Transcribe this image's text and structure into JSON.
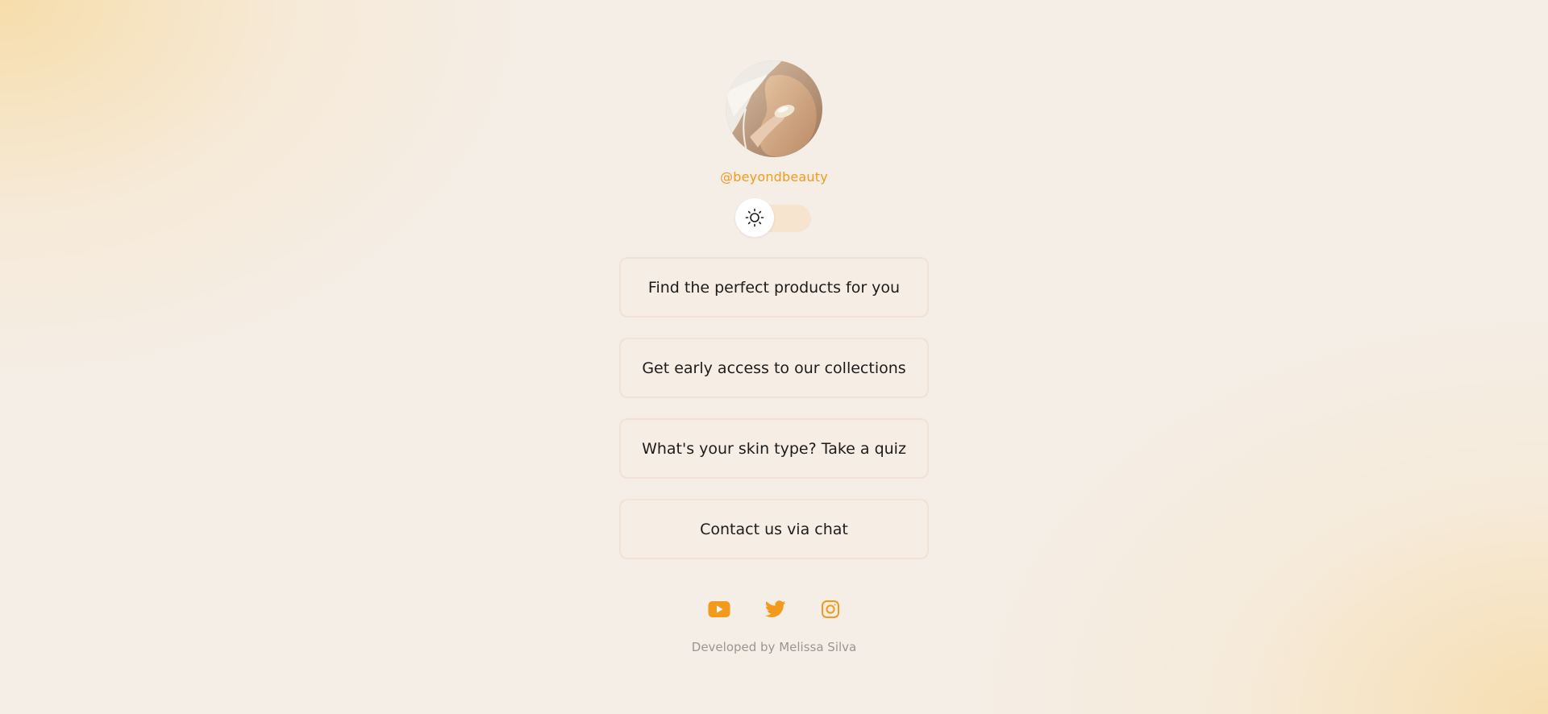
{
  "profile": {
    "handle": "@beyondbeauty",
    "avatar_alt": "profile-photo"
  },
  "theme_toggle": {
    "icon": "sun-icon",
    "state": "light"
  },
  "links": [
    {
      "label": "Find the perfect products for you"
    },
    {
      "label": "Get early access to our collections"
    },
    {
      "label": "What's your skin type? Take a quiz"
    },
    {
      "label": "Contact us via chat"
    }
  ],
  "socials": [
    {
      "icon": "youtube-icon"
    },
    {
      "icon": "twitter-icon"
    },
    {
      "icon": "instagram-icon"
    }
  ],
  "footer": {
    "text": "Developed by Melissa Silva"
  },
  "colors": {
    "accent": "#f39a1c",
    "background": "#f5eee7",
    "button_border": "#f2e2d6",
    "toggle_track": "#f6e4ce",
    "footer_text": "#9a9592"
  }
}
